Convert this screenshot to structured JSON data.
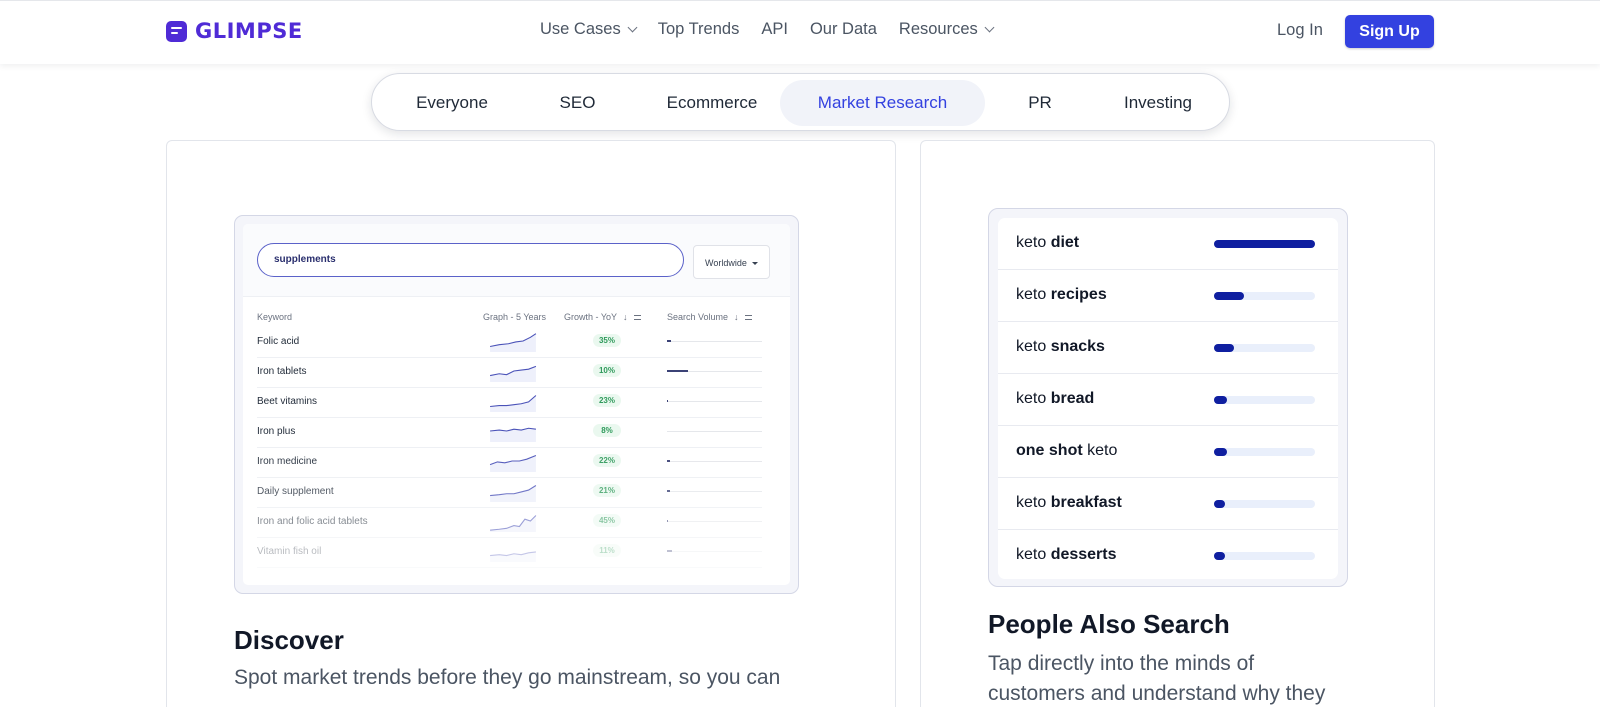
{
  "header": {
    "logo_text": "GLIMPSE",
    "nav": [
      {
        "label": "Use Cases",
        "has_dropdown": true
      },
      {
        "label": "Top Trends",
        "has_dropdown": false
      },
      {
        "label": "API",
        "has_dropdown": false
      },
      {
        "label": "Our Data",
        "has_dropdown": false
      },
      {
        "label": "Resources",
        "has_dropdown": true
      }
    ],
    "login_label": "Log In",
    "signup_label": "Sign Up"
  },
  "tabs": [
    {
      "label": "Everyone",
      "active": false
    },
    {
      "label": "SEO",
      "active": false
    },
    {
      "label": "Ecommerce",
      "active": false
    },
    {
      "label": "Market Research",
      "active": true
    },
    {
      "label": "PR",
      "active": false
    },
    {
      "label": "Investing",
      "active": false
    }
  ],
  "discover": {
    "title": "Discover",
    "description": "Spot market trends before they go mainstream, so you can",
    "mock": {
      "search_value": "supplements",
      "region": "Worldwide",
      "columns": [
        "Keyword",
        "Graph - 5 Years",
        "Growth - YoY",
        "Search Volume"
      ],
      "rows": [
        {
          "keyword": "Folic acid",
          "growth": "35%",
          "volume": 0.04
        },
        {
          "keyword": "Iron tablets",
          "growth": "10%",
          "volume": 0.22
        },
        {
          "keyword": "Beet vitamins",
          "growth": "23%",
          "volume": 0.01
        },
        {
          "keyword": "Iron plus",
          "growth": "8%",
          "volume": 0.0
        },
        {
          "keyword": "Iron medicine",
          "growth": "22%",
          "volume": 0.03
        },
        {
          "keyword": "Daily supplement",
          "growth": "21%",
          "volume": 0.03
        },
        {
          "keyword": "Iron and folic acid tablets",
          "growth": "45%",
          "volume": 0.01
        },
        {
          "keyword": "Vitamin fish oil",
          "growth": "11%",
          "volume": 0.05
        }
      ]
    }
  },
  "people_also_search": {
    "title": "People Also Search",
    "description_lines": [
      "Tap directly into the minds of",
      "customers and understand why they"
    ],
    "items": [
      {
        "prefix": "keto ",
        "bold": "diet",
        "suffix": "",
        "value": 1.0
      },
      {
        "prefix": "keto ",
        "bold": "recipes",
        "suffix": "",
        "value": 0.3
      },
      {
        "prefix": "keto ",
        "bold": "snacks",
        "suffix": "",
        "value": 0.2
      },
      {
        "prefix": "keto ",
        "bold": "bread",
        "suffix": "",
        "value": 0.13
      },
      {
        "prefix": "",
        "bold": "one shot",
        "suffix": " keto",
        "value": 0.13
      },
      {
        "prefix": "keto ",
        "bold": "breakfast",
        "suffix": "",
        "value": 0.11
      },
      {
        "prefix": "keto ",
        "bold": "desserts",
        "suffix": "",
        "value": 0.11
      }
    ]
  },
  "colors": {
    "brand": "#4f2bd6",
    "accent": "#3341e0",
    "bar_fill": "#0f1fa0",
    "bar_track": "#e9effb",
    "growth_text": "#2f9a5b",
    "growth_bg": "#eaf8ef"
  }
}
